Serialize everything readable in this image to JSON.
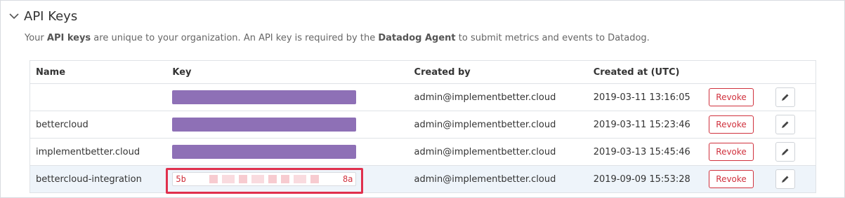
{
  "section": {
    "title": "API Keys",
    "desc_prefix": "Your ",
    "desc_strong1": "API keys",
    "desc_mid": " are unique to your organization. An API key is required by the ",
    "desc_strong2": "Datadog Agent",
    "desc_suffix": " to submit metrics and events to Datadog."
  },
  "table": {
    "headers": [
      "Name",
      "Key",
      "Created by",
      "Created at (UTC)"
    ],
    "revoke_label": "Revoke",
    "rows": [
      {
        "name": "",
        "key_masked": true,
        "created_by": "admin@implementbetter.cloud",
        "created_at": "2019-03-11 13:16:05"
      },
      {
        "name": "bettercloud",
        "key_masked": true,
        "created_by": "admin@implementbetter.cloud",
        "created_at": "2019-03-11 15:23:46"
      },
      {
        "name": "implementbetter.cloud",
        "key_masked": true,
        "created_by": "admin@implementbetter.cloud",
        "created_at": "2019-03-13 15:45:46"
      },
      {
        "name": "bettercloud-integration",
        "key_start": "5b",
        "key_end": "8a",
        "created_by": "admin@implementbetter.cloud",
        "created_at": "2019-09-09 15:53:28"
      }
    ]
  },
  "colors": {
    "key_bar": "#8e70b6",
    "revoke": "#d0313d",
    "highlight_row": "#eef4fa",
    "highlight_box": "#e0304d"
  },
  "icons": {
    "collapse": "chevron-down-icon",
    "edit": "pencil-icon"
  }
}
